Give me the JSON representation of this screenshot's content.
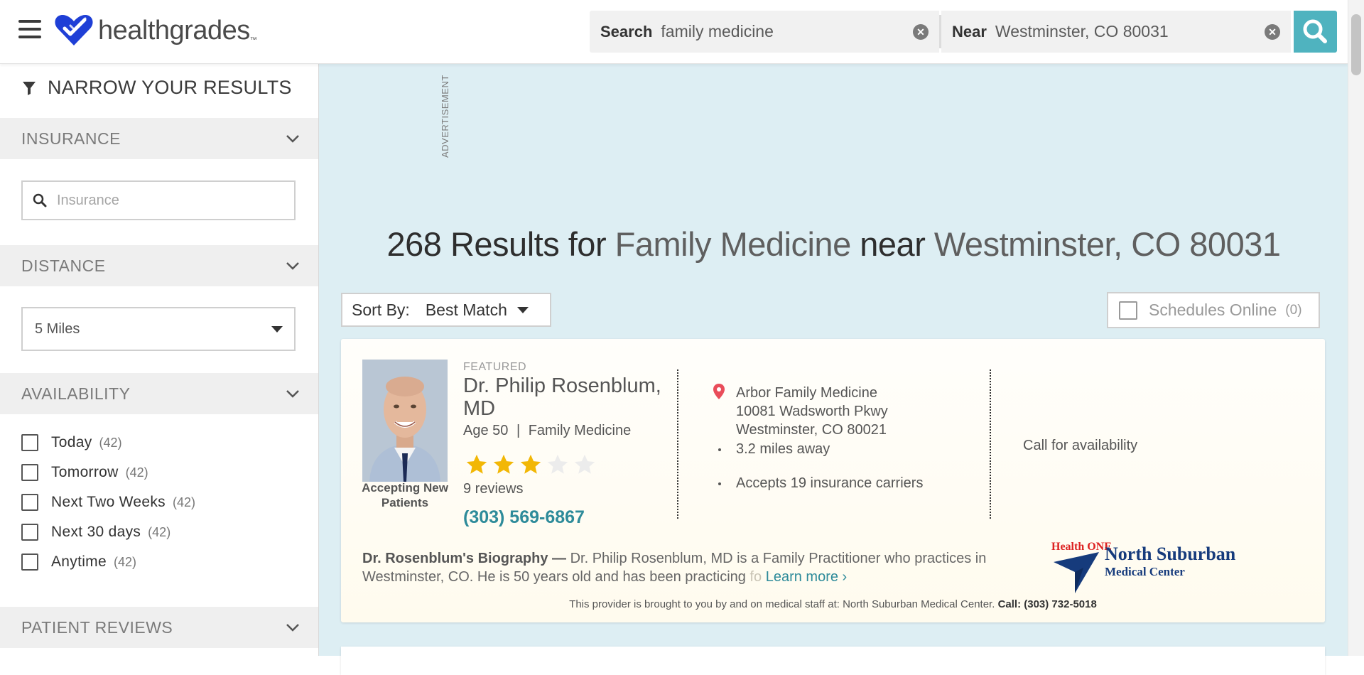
{
  "header": {
    "logo_text": "healthgrades",
    "logo_tm": "™",
    "search": {
      "label": "Search",
      "value": "family medicine"
    },
    "near": {
      "label": "Near",
      "value": "Westminster, CO 80031"
    },
    "brand_color": "#1f3fd6",
    "accent_color": "#4fb3bf"
  },
  "sidebar": {
    "title": "NARROW YOUR RESULTS",
    "insurance": {
      "title": "INSURANCE",
      "placeholder": "Insurance"
    },
    "distance": {
      "title": "DISTANCE",
      "value": "5 Miles"
    },
    "availability": {
      "title": "AVAILABILITY",
      "options": [
        {
          "label": "Today",
          "count": "(42)"
        },
        {
          "label": "Tomorrow",
          "count": "(42)"
        },
        {
          "label": "Next Two Weeks",
          "count": "(42)"
        },
        {
          "label": "Next 30 days",
          "count": "(42)"
        },
        {
          "label": "Anytime",
          "count": "(42)"
        }
      ]
    },
    "patient_reviews": {
      "title": "PATIENT REVIEWS"
    }
  },
  "main": {
    "ad_label": "ADVERTISEMENT",
    "results": {
      "count_text": "268 Results for",
      "specialty": "Family Medicine",
      "near_word": "near",
      "location": "Westminster, CO 80031"
    },
    "sort": {
      "label": "Sort By:",
      "value": "Best Match"
    },
    "schedules_online": {
      "label": "Schedules Online",
      "count": "(0)"
    },
    "card": {
      "featured": "FEATURED",
      "name": "Dr. Philip Rosenblum, MD",
      "age": "Age 50",
      "separator": "|",
      "specialty": "Family Medicine",
      "rating": 3,
      "rating_max": 5,
      "reviews": "9 reviews",
      "phone": "(303) 569-6867",
      "accepting": "Accepting New Patients",
      "practice_name": "Arbor Family Medicine",
      "address_line1": "10081 Wadsworth Pkwy",
      "address_line2": "Westminster, CO 80021",
      "distance": "3.2 miles away",
      "insurance": "Accepts 19 insurance carriers",
      "availability": "Call for availability",
      "bio_title": "Dr. Rosenblum's Biography —",
      "bio_text": "Dr. Philip Rosenblum, MD is a Family Practitioner who practices in Westminster, CO. He is 50 years old and has been practicing",
      "bio_fade": "fo",
      "learn_more": "Learn more ›",
      "hospital_badge": "Health ONE",
      "hospital_name1": "North Suburban",
      "hospital_name2": "Medical Center",
      "staff_note": "This provider is brought to you by and on medical staff at: North Suburban Medical Center.",
      "staff_call": "Call: (303) 732-5018",
      "star_color": "#f2b705"
    }
  }
}
